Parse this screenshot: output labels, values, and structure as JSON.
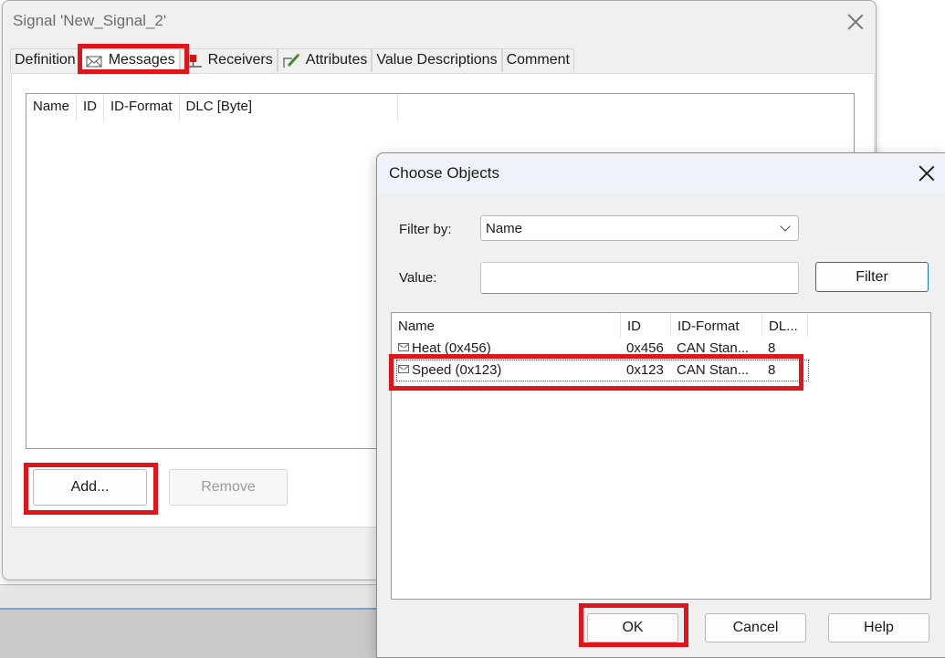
{
  "background": {
    "taskbar_color": "#c9c9c9"
  },
  "signal_dialog": {
    "title": "Signal 'New_Signal_2'",
    "tabs": [
      {
        "label": "Definition",
        "icon": null
      },
      {
        "label": "Messages",
        "icon": "envelope-icon",
        "active": true
      },
      {
        "label": "Receivers",
        "icon": "red-node-icon"
      },
      {
        "label": "Attributes",
        "icon": "attributes-pen-icon"
      },
      {
        "label": "Value Descriptions",
        "icon": null
      },
      {
        "label": "Comment",
        "icon": null
      }
    ],
    "columns": [
      "Name",
      "ID",
      "ID-Format",
      "DLC [Byte]"
    ],
    "add_label": "Add...",
    "remove_label": "Remove"
  },
  "choose_dialog": {
    "title": "Choose Objects",
    "filter_by_label": "Filter by:",
    "filter_by_value": "Name",
    "value_label": "Value:",
    "value_text": "",
    "filter_button": "Filter",
    "columns": [
      "Name",
      "ID",
      "ID-Format",
      "DL..."
    ],
    "rows": [
      {
        "name": "Heat (0x456)",
        "id": "0x456",
        "format": "CAN Stan...",
        "dlc": "8",
        "icon": "envelope-icon"
      },
      {
        "name": "Speed (0x123)",
        "id": "0x123",
        "format": "CAN Stan...",
        "dlc": "8",
        "icon": "envelope-icon",
        "focused": true
      }
    ],
    "ok_label": "OK",
    "cancel_label": "Cancel",
    "help_label": "Help"
  },
  "highlight_color": "#e0151b"
}
